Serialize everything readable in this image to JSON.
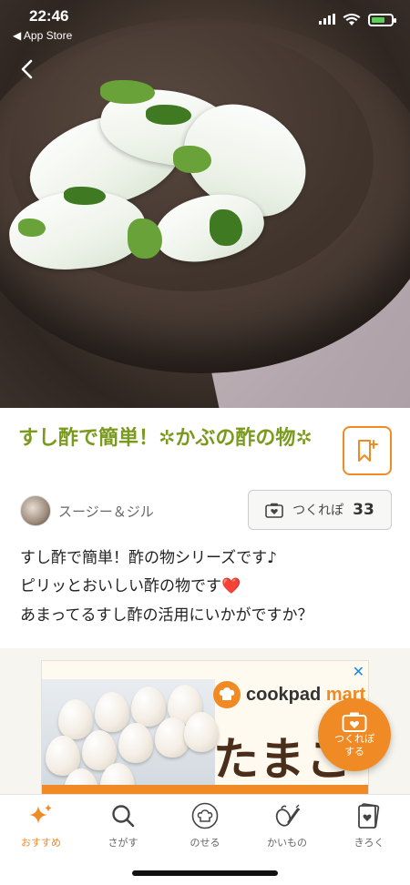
{
  "status_bar": {
    "time": "22:46",
    "back_app": "◀ App Store"
  },
  "recipe": {
    "title": "すし酢で簡単！✲かぶの酢の物✲",
    "author": "スージー＆ジル",
    "tsukurepo_label": "つくれぽ",
    "tsukurepo_count": "33",
    "description": [
      "すし酢で簡単！酢の物シリーズです♪",
      "ピリッとおいしい酢の物です",
      "あまってるすし酢の活用にいかがですか？"
    ],
    "heart": "❤️"
  },
  "ad": {
    "logo_main": "cookpad",
    "logo_accent": "mart",
    "headline": "たまご",
    "close": "✕"
  },
  "fab": {
    "label_line1": "つくれぽ",
    "label_line2": "する"
  },
  "tabs": [
    {
      "label": "おすすめ",
      "icon": "sparkle-icon",
      "active": true
    },
    {
      "label": "さがす",
      "icon": "search-icon",
      "active": false
    },
    {
      "label": "のせる",
      "icon": "chef-hat-icon",
      "active": false
    },
    {
      "label": "かいもの",
      "icon": "vegetables-icon",
      "active": false
    },
    {
      "label": "きろく",
      "icon": "record-icon",
      "active": false
    }
  ],
  "colors": {
    "accent": "#f08a24",
    "title": "#7a9a1e",
    "heart": "#e8302e"
  }
}
